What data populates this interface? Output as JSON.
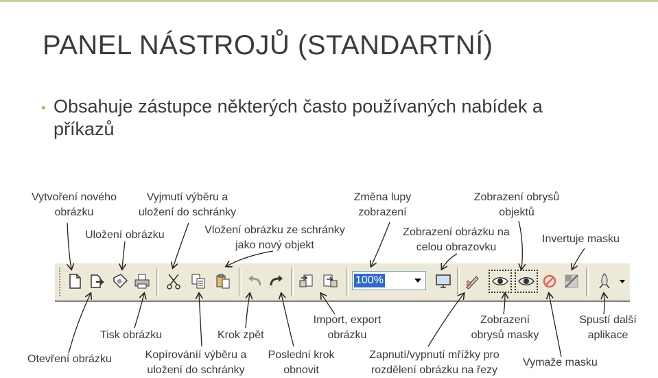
{
  "title": "PANEL NÁSTROJŮ (STANDARTNÍ)",
  "bullet": "Obsahuje zástupce některých často používaných nabídek a příkazů",
  "labels_top": {
    "new_image": "Vytvoření nového obrázku",
    "save_image": "Uložení obrázku",
    "cut": "Vyjmutí výběru a uložení do schránky",
    "paste_new": "Vložení obrázku ze schránky jako nový objekt",
    "zoom_change": "Změna lupy zobrazení",
    "fullscreen": "Zobrazení obrázku na celou obrazovku",
    "object_outlines": "Zobrazení obrysů objektů",
    "invert_mask": "Invertuje masku"
  },
  "labels_bottom": {
    "open_image": "Otevření obrázku",
    "print_image": "Tisk obrázku",
    "copy": "Kopírováníí výběru a uložení do schránky",
    "undo": "Krok zpět",
    "redo": "Poslední krok obnovit",
    "import_export": "Import, export obrázku",
    "grid_toggle": "Zapnutí/vypnutí mřížky pro rozdělení obrázku na řezy",
    "mask_outlines": "Zobrazení obrysů masky",
    "remove_mask": "Vymaže masku",
    "launch_app": "Spustí další aplikace"
  },
  "toolbar": {
    "zoom_value": "100%",
    "buttons": [
      {
        "name": "new-file-icon"
      },
      {
        "name": "open-file-icon"
      },
      {
        "name": "save-icon"
      },
      {
        "name": "print-icon"
      },
      {
        "name": "cut-icon"
      },
      {
        "name": "copy-icon"
      },
      {
        "name": "paste-new-icon"
      },
      {
        "name": "undo-icon"
      },
      {
        "name": "redo-icon"
      },
      {
        "name": "import-icon"
      },
      {
        "name": "export-icon"
      },
      {
        "name": "fullscreen-icon"
      },
      {
        "name": "grid-pen-icon"
      },
      {
        "name": "object-outline-eye-icon"
      },
      {
        "name": "mask-outline-eye-icon"
      },
      {
        "name": "remove-mask-icon"
      },
      {
        "name": "invert-mask-icon"
      },
      {
        "name": "launch-app-icon"
      }
    ]
  },
  "colors": {
    "accent": "#9bbb59",
    "toolbar_bg": "#ece9d8",
    "zoom_highlight": "#316ac5"
  }
}
